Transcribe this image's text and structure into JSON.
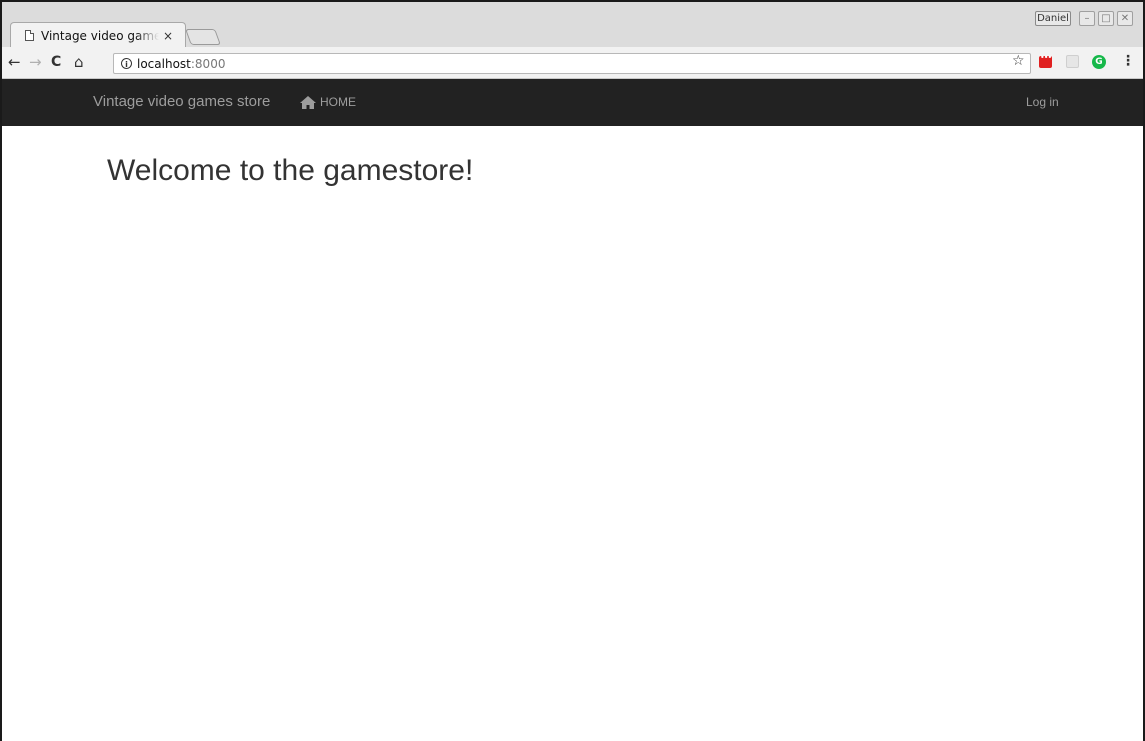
{
  "browser": {
    "tab": {
      "title": "Vintage video games store",
      "close": "×"
    },
    "profile": "Daniel",
    "window_controls": {
      "minimize": "–",
      "maximize": "□",
      "close": "✕"
    },
    "address": {
      "host": "localhost",
      "port": ":8000"
    },
    "icons": {
      "page": "page-icon",
      "back": "arrow-left-icon",
      "forward": "arrow-right-icon",
      "reload": "reload-icon",
      "home": "home-icon",
      "info": "info-icon",
      "bookmark": "star-icon",
      "extension_1": "red-extension-icon",
      "extension_2": "grey-extension-icon",
      "extension_3": "grammarly-icon",
      "menu": "kebab-menu-icon"
    }
  },
  "navbar": {
    "brand": "Vintage video games store",
    "home_label": "HOME",
    "login_label": "Log in",
    "background": "#222222",
    "text_color": "#9d9d9d"
  },
  "main": {
    "heading": "Welcome to the gamestore!"
  }
}
